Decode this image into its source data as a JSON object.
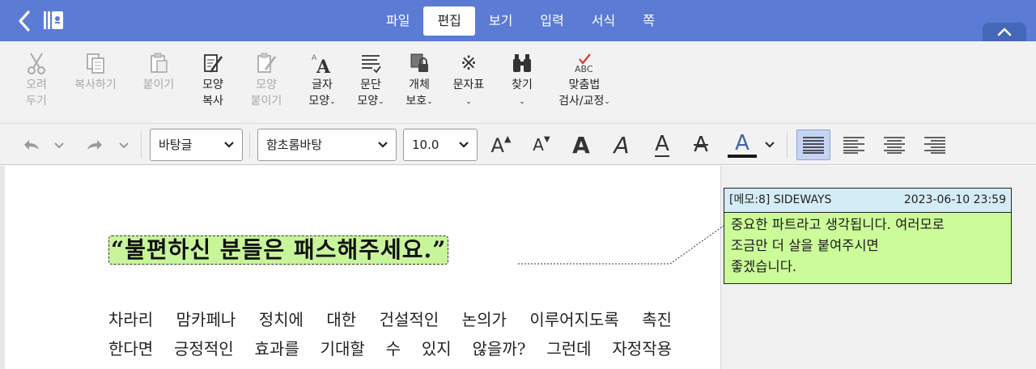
{
  "menubar": {
    "tabs": [
      "파일",
      "편집",
      "보기",
      "입력",
      "서식",
      "쪽"
    ],
    "active_tab": "편집",
    "bg_color": "#5b7bd5"
  },
  "ribbon": {
    "items": [
      {
        "label": "오려\n두기",
        "icon": "scissors-icon",
        "disabled": true
      },
      {
        "label": "복사하기",
        "icon": "copy-icon",
        "disabled": true
      },
      {
        "label": "붙이기",
        "icon": "paste-icon",
        "disabled": true
      },
      {
        "label": "모양\n복사",
        "icon": "format-painter-icon",
        "disabled": false
      },
      {
        "label": "모양\n붙이기",
        "icon": "format-paste-icon",
        "disabled": true
      },
      {
        "label": "글자\n모양",
        "icon": "char-shape-icon",
        "disabled": false
      },
      {
        "label": "문단\n모양",
        "icon": "para-shape-icon",
        "disabled": false
      },
      {
        "label": "개체\n보호",
        "icon": "lock-object-icon",
        "disabled": false
      },
      {
        "label": "문자표",
        "icon": "symbol-icon",
        "disabled": false
      },
      {
        "label": "찾기",
        "icon": "binoculars-icon",
        "disabled": false
      },
      {
        "label": "맞춤법\n검사/교정",
        "icon": "spellcheck-icon",
        "disabled": false
      }
    ]
  },
  "format": {
    "style": "바탕글",
    "font": "함초롬바탕",
    "size": "10.0",
    "glyph": "A",
    "font_color": "#1a1a1a"
  },
  "document": {
    "quote": "“불편하신 분들은 패스해주세요.”",
    "para_lines": [
      "차라리 맘카페나 정치에 대한 건설적인 논의가 이루어지도록 촉진",
      "한다면 긍정적인 효과를 기대할 수 있지 않을까? 그런데 자정작용"
    ],
    "highlight_color": "#c8f59a"
  },
  "memo": {
    "header": "[메모:8] SIDEWAYS",
    "date": "2023-06-10 23:59",
    "body_lines": [
      "중요한 파트라고 생각됩니다. 여러모로",
      "조금만 더 살을 붙여주시면",
      "좋겠습니다."
    ],
    "bg_color": "#ccfc9a"
  }
}
